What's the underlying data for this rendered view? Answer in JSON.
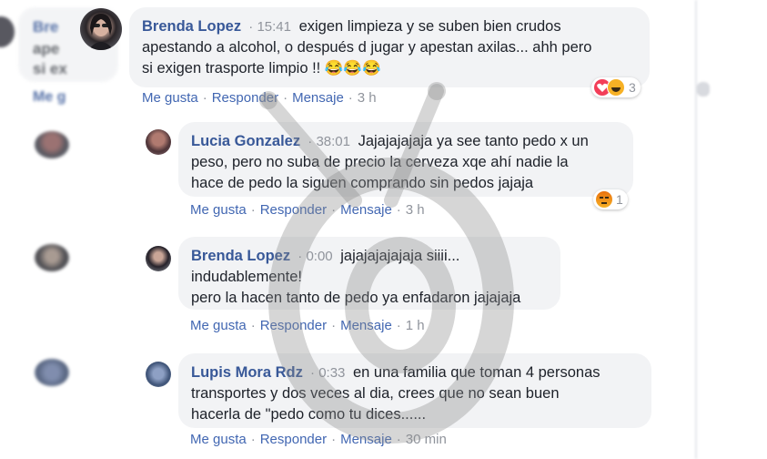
{
  "background": {
    "left_snippet": {
      "name": "Bre",
      "line2": "ape",
      "line3": "si ex",
      "link": "Me g"
    }
  },
  "comments": [
    {
      "author": "Brenda Lopez",
      "time": "15:41",
      "text_line1": "exigen limpieza y se suben bien crudos",
      "text_line2": "apestando a alcohol, o después d jugar y apestan axilas... ahh pero",
      "text_line3": "si exigen trasporte limpio !!",
      "emojis": "😂😂😂",
      "reactions": {
        "icons": [
          "love-icon",
          "haha-icon"
        ],
        "count": "3"
      },
      "actions": {
        "like": "Me gusta",
        "reply": "Responder",
        "message": "Mensaje",
        "age": "3 h"
      }
    },
    {
      "author": "Lucia Gonzalez",
      "time": "38:01",
      "text_line1": "Jajajajajaja ya see tanto pedo x un",
      "text_line2": "peso, pero no suba de precio la cerveza xqe ahí nadie la",
      "text_line3": "hace de pedo la siguen comprando sin pedos jajaja",
      "reactions": {
        "icons": [
          "angry-icon"
        ],
        "count": "1"
      },
      "actions": {
        "like": "Me gusta",
        "reply": "Responder",
        "message": "Mensaje",
        "age": "3 h"
      }
    },
    {
      "author": "Brenda Lopez",
      "time": "0:00",
      "text_line1": "jajajajajajaja siiii...",
      "text_line2": "indudablemente!",
      "text_line3": "pero la hacen tanto de pedo ya enfadaron jajajaja",
      "actions": {
        "like": "Me gusta",
        "reply": "Responder",
        "message": "Mensaje",
        "age": "1 h"
      }
    },
    {
      "author": "Lupis Mora Rdz",
      "time": "0:33",
      "text_line1": "en una familia que toman 4 personas",
      "text_line2": "transportes y dos veces al dia, crees que no sean buen",
      "text_line3": "hacerla de \"pedo como tu dices......",
      "actions": {
        "like": "Me gusta",
        "reply": "Responder",
        "message": "Mensaje",
        "age": "30 min"
      }
    }
  ],
  "colors": {
    "link": "#385898",
    "action": "#4267b2",
    "meta": "#90949c",
    "bubble": "#f2f3f5"
  }
}
